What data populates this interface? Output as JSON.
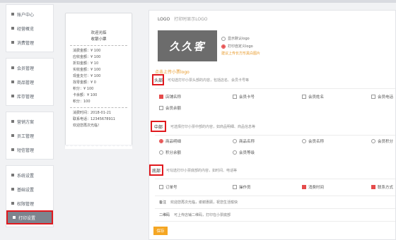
{
  "sidebar": {
    "groups": [
      [
        {
          "label": "账户中心",
          "icon": "user-icon"
        },
        {
          "label": "经营概览",
          "icon": "chart-icon"
        },
        {
          "label": "消费管理",
          "icon": "list-icon"
        }
      ],
      [
        {
          "label": "会员管理",
          "icon": "member-icon"
        },
        {
          "label": "商品管理",
          "icon": "goods-icon"
        },
        {
          "label": "库存管理",
          "icon": "box-icon"
        }
      ],
      [
        {
          "label": "营销方案",
          "icon": "gift-icon"
        },
        {
          "label": "员工管理",
          "icon": "staff-icon"
        },
        {
          "label": "短信管理",
          "icon": "sms-icon"
        }
      ],
      [
        {
          "label": "系统设置",
          "icon": "gear-icon"
        },
        {
          "label": "基础设置",
          "icon": "settings-icon"
        },
        {
          "label": "权限管理",
          "icon": "lock-icon"
        },
        {
          "label": "打印设置",
          "icon": "print-icon",
          "active": true
        }
      ]
    ]
  },
  "receipt": {
    "shop": "欢迎光临",
    "subtitle": "收银小票",
    "lines": [
      "消费金额：¥ 100",
      "应收金额：¥ 100",
      "折扣金额：¥ 10",
      "实收金额：¥ 100",
      "现金支付：¥ 100",
      "找零金额：¥ 0",
      "积分：¥ 100",
      "卡余额：¥ 100",
      "积分：100"
    ],
    "footer": [
      "消费时间：2018-01-21",
      "联系电话：12345678911",
      "欢迎您再次光临！"
    ]
  },
  "logo": {
    "label": "LOGO",
    "tip": "打印时显示LOGO",
    "logo_text": "久久客",
    "options": [
      {
        "label": "显示默认logo",
        "selected": false
      },
      {
        "label": "打印自定义logo",
        "selected": true
      }
    ],
    "hint": "建议上传长方形黑白图片",
    "upload_link": "点击上传小票logo"
  },
  "sections": {
    "head": {
      "label": "头部",
      "desc": "可勾选打印小票头部的内容，包括店名、会员卡号等",
      "options": [
        {
          "label": "店铺名称",
          "checked": true
        },
        {
          "label": "会员卡号",
          "checked": false
        },
        {
          "label": "会员姓名",
          "checked": false
        },
        {
          "label": "会员电话",
          "checked": false
        },
        {
          "label": "会员余额",
          "checked": false
        }
      ]
    },
    "middle": {
      "label": "中部",
      "desc": "可选择打印小票中部的内容，如商品明细、商品信息等",
      "options": [
        {
          "label": "商品明细",
          "selected": true
        },
        {
          "label": "商品名称",
          "selected": false
        },
        {
          "label": "会员名称",
          "selected": false
        },
        {
          "label": "会员积分",
          "selected": false
        },
        {
          "label": "积分余额",
          "selected": false
        },
        {
          "label": "会员等级",
          "selected": false
        }
      ]
    },
    "foot": {
      "label": "底部",
      "desc": "可勾选打印小票底部的内容，如时间、电话等",
      "options": [
        {
          "label": "订单号",
          "checked": false
        },
        {
          "label": "操作员",
          "checked": false
        },
        {
          "label": "消费时间",
          "checked": true
        },
        {
          "label": "联系方式",
          "checked": true
        }
      ]
    }
  },
  "extra": {
    "remark_key": "备注",
    "remark_value": "欢迎您再次光临，谢谢惠顾，祝您生活愉快",
    "qrcode_key": "二维码",
    "qrcode_value": "可上传店铺二维码，打印在小票底部"
  },
  "save_label": "保存"
}
